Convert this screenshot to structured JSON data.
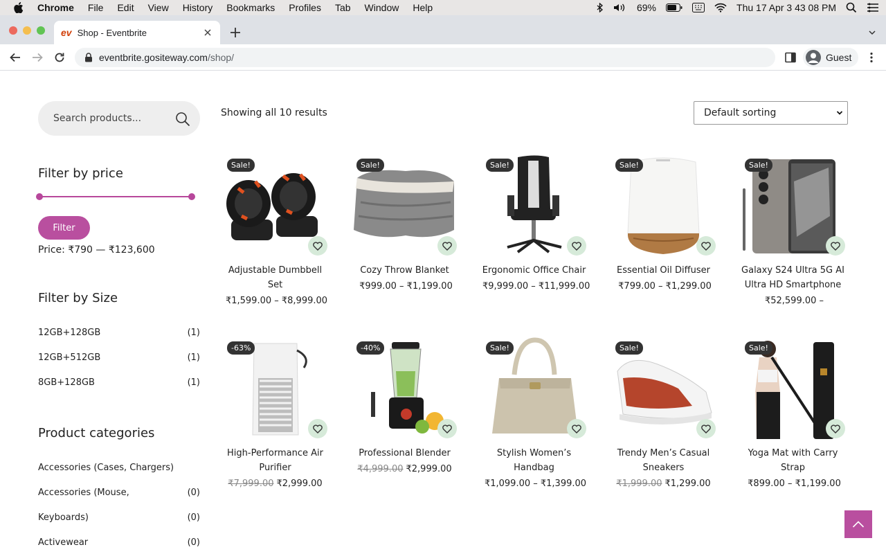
{
  "menubar": {
    "app": "Chrome",
    "items": [
      "File",
      "Edit",
      "View",
      "History",
      "Bookmarks",
      "Profiles",
      "Tab",
      "Window",
      "Help"
    ],
    "battery": "69%",
    "datetime": "Thu 17 Apr  3 43 08 PM"
  },
  "browser": {
    "tab_favicon": "ev",
    "tab_title": "Shop - Eventbrite",
    "url_host": "eventbrite.gositeway.com",
    "url_path": "/shop/",
    "profile": "Guest"
  },
  "sidebar": {
    "search_placeholder": "Search products...",
    "price_title": "Filter by price",
    "filter_label": "Filter",
    "price_range": "Price: ₹790 — ₹123,600",
    "size_title": "Filter by Size",
    "sizes": [
      {
        "label": "12GB+128GB",
        "count": "(1)"
      },
      {
        "label": "12GB+512GB",
        "count": "(1)"
      },
      {
        "label": "8GB+128GB",
        "count": "(1)"
      }
    ],
    "categories_title": "Product categories",
    "categories": [
      {
        "label": "Accessories (Cases, Chargers)",
        "count": ""
      },
      {
        "label": "Accessories (Mouse,",
        "count": "(0)"
      },
      {
        "label": "Keyboards)",
        "count": "(0)"
      },
      {
        "label": "Activewear",
        "count": "(0)"
      }
    ]
  },
  "shop": {
    "results": "Showing all 10 results",
    "sorting": "Default sorting",
    "products": [
      {
        "name": "Adjustable Dumbbell Set",
        "badge": "Sale!",
        "old": "",
        "price": "₹1,599.00 – ₹8,999.00"
      },
      {
        "name": "Cozy Throw Blanket",
        "badge": "Sale!",
        "old": "",
        "price": "₹999.00 – ₹1,199.00"
      },
      {
        "name": "Ergonomic Office Chair",
        "badge": "Sale!",
        "old": "",
        "price": "₹9,999.00 – ₹11,999.00"
      },
      {
        "name": "Essential Oil Diffuser",
        "badge": "Sale!",
        "old": "",
        "price": "₹799.00 – ₹1,299.00"
      },
      {
        "name": "Galaxy S24 Ultra 5G AI Ultra HD Smartphone",
        "badge": "Sale!",
        "old": "",
        "price": "₹52,599.00 –"
      },
      {
        "name": "High-Performance Air Purifier",
        "badge": "-63%",
        "old": "₹7,999.00",
        "price": "₹2,999.00"
      },
      {
        "name": "Professional Blender",
        "badge": "-40%",
        "old": "₹4,999.00",
        "price": "₹2,999.00"
      },
      {
        "name": "Stylish Women’s Handbag",
        "badge": "Sale!",
        "old": "",
        "price": "₹1,099.00 – ₹1,399.00"
      },
      {
        "name": "Trendy Men’s Casual Sneakers",
        "badge": "Sale!",
        "old": "₹1,999.00",
        "price": "₹1,299.00"
      },
      {
        "name": "Yoga Mat with Carry Strap",
        "badge": "Sale!",
        "old": "",
        "price": "₹899.00 – ₹1,199.00"
      }
    ]
  },
  "colors": {
    "accent": "#b94f9f",
    "wishlist_bg": "#d6ead9",
    "badge_bg": "#333333"
  }
}
